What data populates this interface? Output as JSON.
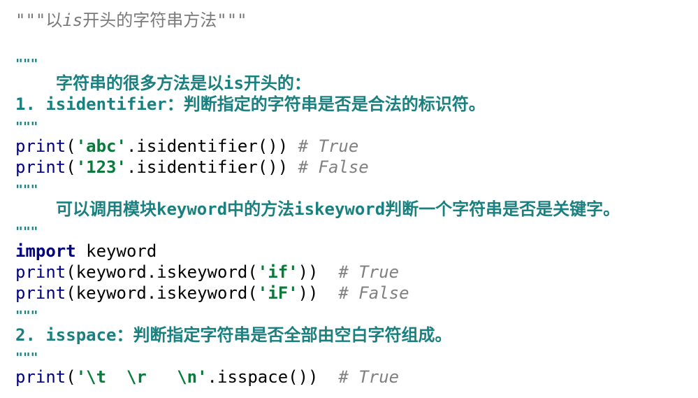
{
  "lines": {
    "title": {
      "open": "\"\"\"",
      "pre": "以",
      "italic": "is",
      "post": "开头的字符串方法",
      "close": "\"\"\""
    },
    "q1": "\"\"\"",
    "doc1": "字符串的很多方法是以is开头的：",
    "doc2_num": "1. isidentifier",
    "doc2_rest": "：判断指定的字符串是否是合法的标识符。",
    "q2": "\"\"\"",
    "p1": {
      "fn": "print",
      "open": "(",
      "str": "'abc'",
      "call": ".isidentifier())",
      "comment": "# True"
    },
    "p2": {
      "fn": "print",
      "open": "(",
      "str": "'123'",
      "call": ".isidentifier())",
      "comment": "# False"
    },
    "q3": "\"\"\"",
    "doc3": "可以调用模块keyword中的方法iskeyword判断一个字符串是否是关键字。",
    "q4": "\"\"\"",
    "imp": {
      "kw": "import",
      "mod": " keyword"
    },
    "p3": {
      "fn": "print",
      "pre": "(keyword.iskeyword(",
      "str": "'if'",
      "post": "))",
      "comment": "# True"
    },
    "p4": {
      "fn": "print",
      "pre": "(keyword.iskeyword(",
      "str": "'iF'",
      "post": "))",
      "comment": "# False"
    },
    "q5": "\"\"\"",
    "doc4_num": "2. isspace",
    "doc4_rest": "：判断指定字符串是否全部由空白字符组成。",
    "q6": "\"\"\"",
    "p5": {
      "fn": "print",
      "open": "(",
      "str": "'\\t  \\r   \\n'",
      "call": ".isspace())",
      "comment": "# True"
    }
  }
}
